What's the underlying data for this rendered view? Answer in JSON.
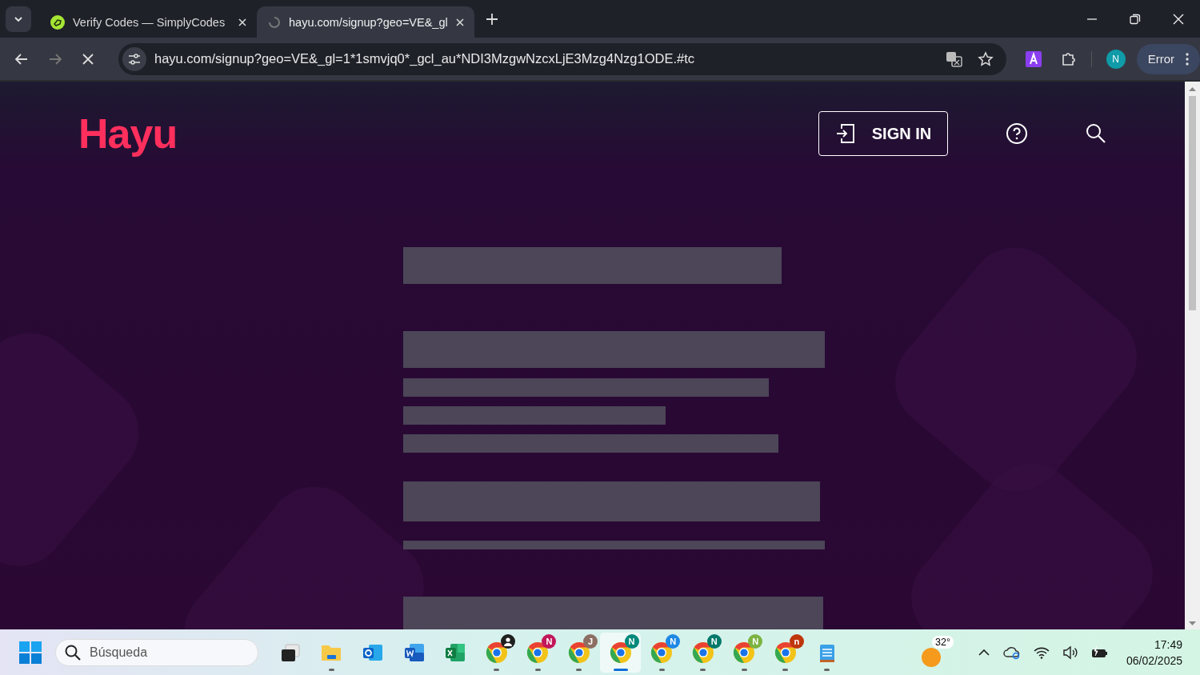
{
  "browser": {
    "tabs": [
      {
        "title": "Verify Codes — SimplyCodes",
        "selected": false
      },
      {
        "title": "hayu.com/signup?geo=VE&_gl",
        "selected": true
      }
    ],
    "address": "hayu.com/signup?geo=VE&_gl=1*1smvjq0*_gcl_au*NDI3MzgwNzcxLjE3Mzg4Nzg1ODE.#tc",
    "profile": "N",
    "status_button": "Error"
  },
  "page": {
    "logo": "Hayu",
    "sign_in": "SIGN IN"
  },
  "taskbar": {
    "search_placeholder": "Búsqueda",
    "apps": [
      {
        "kind": "taskview",
        "running": false,
        "selected": false
      },
      {
        "kind": "explorer",
        "running": true,
        "selected": false
      },
      {
        "kind": "outlook",
        "running": false,
        "selected": false
      },
      {
        "kind": "word",
        "running": false,
        "selected": false
      },
      {
        "kind": "excel",
        "running": false,
        "selected": false
      },
      {
        "kind": "chrome",
        "color": "#1f1f1f",
        "running": true,
        "selected": false
      },
      {
        "kind": "chrome",
        "badge": "N",
        "color": "#c2185b",
        "running": true,
        "selected": false
      },
      {
        "kind": "chrome",
        "badge": "J",
        "color": "#8d6e63",
        "running": true,
        "selected": false
      },
      {
        "kind": "chrome",
        "badge": "N",
        "color": "#00897b",
        "running": true,
        "selected": true
      },
      {
        "kind": "chrome",
        "badge": "N",
        "color": "#1e88e5",
        "running": true,
        "selected": false
      },
      {
        "kind": "chrome",
        "badge": "N",
        "color": "#00796b",
        "running": true,
        "selected": false
      },
      {
        "kind": "chrome",
        "badge": "N",
        "color": "#7cb342",
        "running": true,
        "selected": false
      },
      {
        "kind": "chrome",
        "badge": "n",
        "color": "#bf360c",
        "running": true,
        "selected": false
      },
      {
        "kind": "notepad",
        "running": true,
        "selected": false
      }
    ],
    "temperature": "32°",
    "time": "17:49",
    "date": "06/02/2025"
  }
}
